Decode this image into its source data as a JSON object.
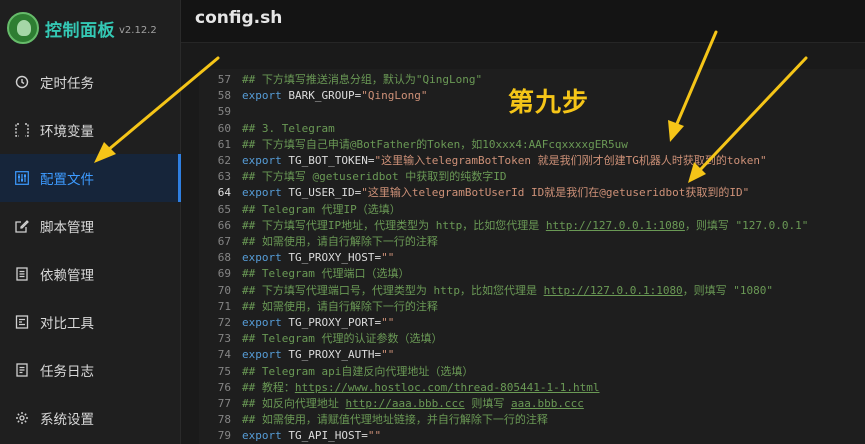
{
  "brand": {
    "title": "控制面板",
    "version": "v2.12.2"
  },
  "nav": [
    {
      "id": "cron",
      "label": "定时任务",
      "icon": "clock-icon",
      "active": false
    },
    {
      "id": "env",
      "label": "环境变量",
      "icon": "brackets-icon",
      "active": false
    },
    {
      "id": "config",
      "label": "配置文件",
      "icon": "sliders-icon",
      "active": true
    },
    {
      "id": "script",
      "label": "脚本管理",
      "icon": "edit-icon",
      "active": false
    },
    {
      "id": "deps",
      "label": "依赖管理",
      "icon": "package-icon",
      "active": false
    },
    {
      "id": "diff",
      "label": "对比工具",
      "icon": "diff-icon",
      "active": false
    },
    {
      "id": "logs",
      "label": "任务日志",
      "icon": "log-icon",
      "active": false
    },
    {
      "id": "settings",
      "label": "系统设置",
      "icon": "gear-icon",
      "active": false
    }
  ],
  "page": {
    "title": "config.sh"
  },
  "annotation": {
    "label": "第九步"
  },
  "accent": "#f5c518",
  "editor": {
    "current_line": 64,
    "lines": [
      {
        "n": 57,
        "parts": [
          [
            "cmt",
            "## 下方填写推送消息分组，默认为\"QingLong\""
          ]
        ]
      },
      {
        "n": 58,
        "parts": [
          [
            "kw",
            "export "
          ],
          [
            "var",
            "BARK_GROUP="
          ],
          [
            "str",
            "\"QingLong\""
          ]
        ]
      },
      {
        "n": 59,
        "parts": []
      },
      {
        "n": 60,
        "parts": [
          [
            "cmt",
            "## 3. Telegram"
          ]
        ]
      },
      {
        "n": 61,
        "parts": [
          [
            "cmt",
            "## 下方填写自己申请@BotFather的Token，如10xxx4:AAFcqxxxxgER5uw"
          ]
        ]
      },
      {
        "n": 62,
        "parts": [
          [
            "kw",
            "export "
          ],
          [
            "var",
            "TG_BOT_TOKEN="
          ],
          [
            "str",
            "\"这里输入telegramBotToken 就是我们刚才创建TG机器人时获取到的token\""
          ]
        ]
      },
      {
        "n": 63,
        "parts": [
          [
            "cmt",
            "## 下方填写 @getuseridbot 中获取到的纯数字ID"
          ]
        ]
      },
      {
        "n": 64,
        "parts": [
          [
            "kw",
            "export "
          ],
          [
            "var",
            "TG_USER_ID="
          ],
          [
            "str",
            "\"这里输入telegramBotUserId ID就是我们在@getuseridbot获取到的ID\""
          ]
        ]
      },
      {
        "n": 65,
        "parts": [
          [
            "cmt",
            "## Telegram 代理IP（选填）"
          ]
        ]
      },
      {
        "n": 66,
        "parts": [
          [
            "cmt",
            "## 下方填写代理IP地址，代理类型为 http，比如您代理是 "
          ],
          [
            "cmtu",
            "http://127.0.0.1:1080"
          ],
          [
            "cmt",
            "，则填写 \"127.0.0.1\""
          ]
        ]
      },
      {
        "n": 67,
        "parts": [
          [
            "cmt",
            "## 如需使用，请自行解除下一行的注释"
          ]
        ]
      },
      {
        "n": 68,
        "parts": [
          [
            "kw",
            "export "
          ],
          [
            "var",
            "TG_PROXY_HOST="
          ],
          [
            "str",
            "\"\""
          ]
        ]
      },
      {
        "n": 69,
        "parts": [
          [
            "cmt",
            "## Telegram 代理端口（选填）"
          ]
        ]
      },
      {
        "n": 70,
        "parts": [
          [
            "cmt",
            "## 下方填写代理端口号，代理类型为 http，比如您代理是 "
          ],
          [
            "cmtu",
            "http://127.0.0.1:1080"
          ],
          [
            "cmt",
            "，则填写 \"1080\""
          ]
        ]
      },
      {
        "n": 71,
        "parts": [
          [
            "cmt",
            "## 如需使用，请自行解除下一行的注释"
          ]
        ]
      },
      {
        "n": 72,
        "parts": [
          [
            "kw",
            "export "
          ],
          [
            "var",
            "TG_PROXY_PORT="
          ],
          [
            "str",
            "\"\""
          ]
        ]
      },
      {
        "n": 73,
        "parts": [
          [
            "cmt",
            "## Telegram 代理的认证参数（选填）"
          ]
        ]
      },
      {
        "n": 74,
        "parts": [
          [
            "kw",
            "export "
          ],
          [
            "var",
            "TG_PROXY_AUTH="
          ],
          [
            "str",
            "\"\""
          ]
        ]
      },
      {
        "n": 75,
        "parts": [
          [
            "cmt",
            "## Telegram api自建反向代理地址（选填）"
          ]
        ]
      },
      {
        "n": 76,
        "parts": [
          [
            "cmt",
            "## 教程："
          ],
          [
            "cmtu",
            "https://www.hostloc.com/thread-805441-1-1.html"
          ]
        ]
      },
      {
        "n": 77,
        "parts": [
          [
            "cmt",
            "## 如反向代理地址 "
          ],
          [
            "cmtu",
            "http://aaa.bbb.ccc"
          ],
          [
            "cmt",
            " 则填写 "
          ],
          [
            "cmtu",
            "aaa.bbb.ccc"
          ]
        ]
      },
      {
        "n": 78,
        "parts": [
          [
            "cmt",
            "## 如需使用，请赋值代理地址链接，并自行解除下一行的注释"
          ]
        ]
      },
      {
        "n": 79,
        "parts": [
          [
            "kw",
            "export "
          ],
          [
            "var",
            "TG_API_HOST="
          ],
          [
            "str",
            "\"\""
          ]
        ]
      }
    ]
  }
}
